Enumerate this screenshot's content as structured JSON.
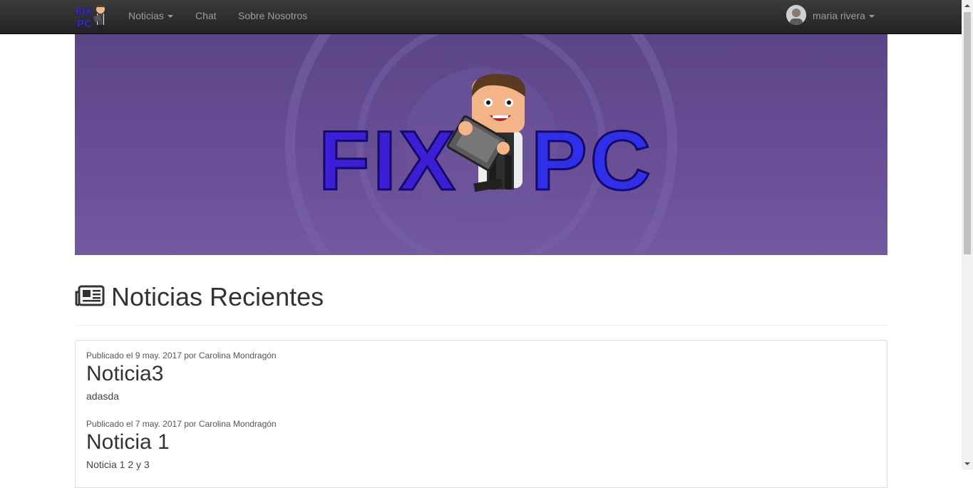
{
  "navbar": {
    "brand_text_top": "FIX",
    "brand_text_bottom": "PC",
    "items": [
      {
        "label": "Noticias",
        "has_caret": true
      },
      {
        "label": "Chat"
      },
      {
        "label": "Sobre Nosotros"
      }
    ],
    "user": {
      "name": "maria rivera"
    }
  },
  "banner": {
    "logo_left": "FIX",
    "logo_right": "PC"
  },
  "section": {
    "title": "Noticias Recientes",
    "icon": "newspaper-icon"
  },
  "news": [
    {
      "meta": "Publicado el 9 may. 2017 por Carolina Mondragón",
      "title": "Noticia3",
      "body": "adasda"
    },
    {
      "meta": "Publicado el 7 may. 2017 por Carolina Mondragón",
      "title": "Noticia 1",
      "body": "Noticia 1 2 y 3"
    }
  ],
  "colors": {
    "navbar": "#222222",
    "nav_text": "#9d9d9d",
    "banner": "#644c91",
    "logo_blue": "#2a1fd0"
  }
}
